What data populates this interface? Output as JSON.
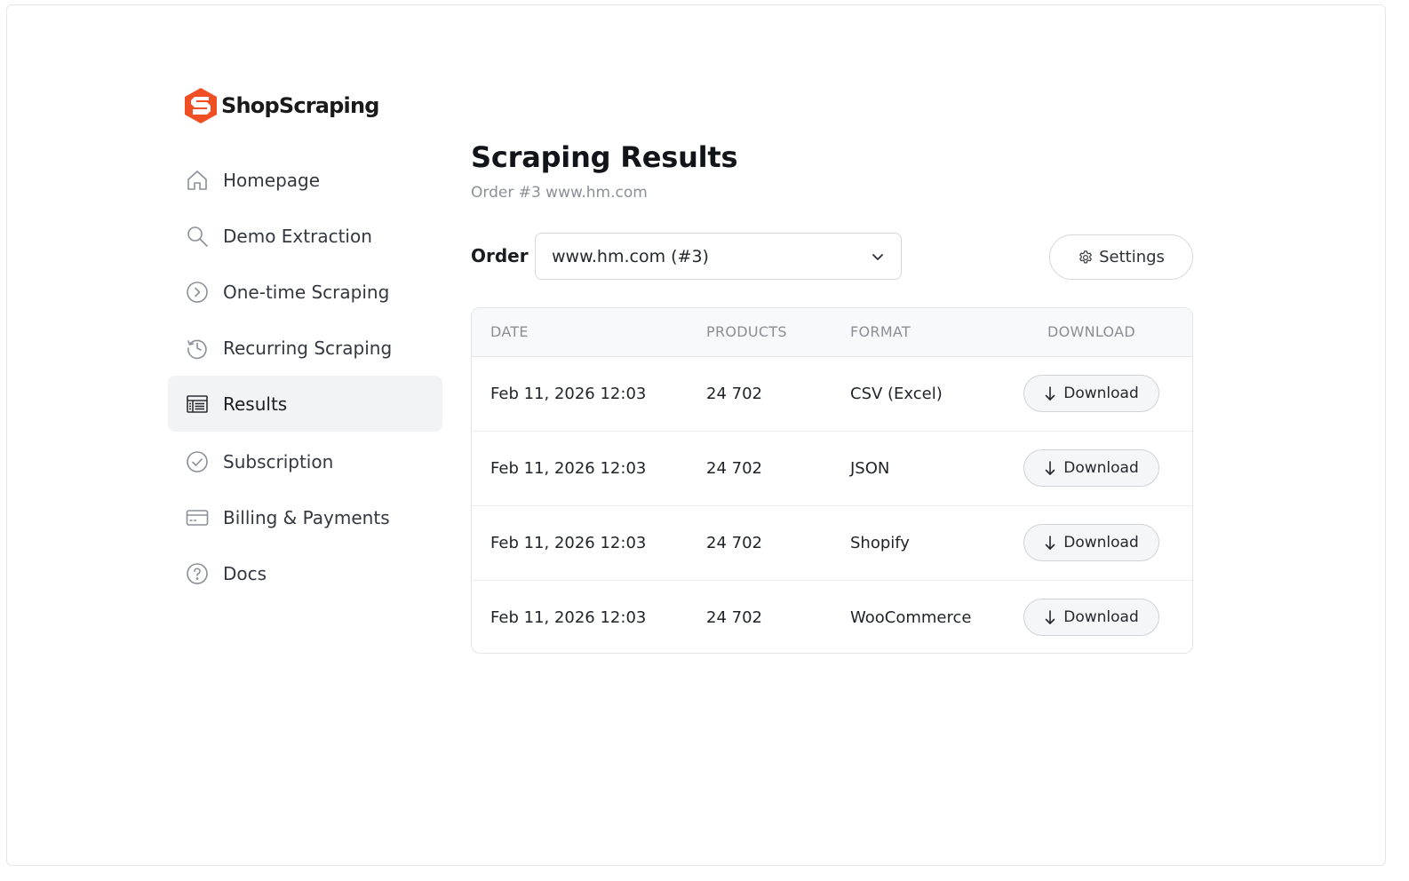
{
  "brand": {
    "name": "ShopScraping",
    "accent": "#f04e23"
  },
  "sidebar": {
    "items": [
      {
        "label": "Homepage",
        "icon": "home-icon"
      },
      {
        "label": "Demo Extraction",
        "icon": "search-icon"
      },
      {
        "label": "One-time Scraping",
        "icon": "chevron-circle-icon"
      },
      {
        "label": "Recurring Scraping",
        "icon": "history-icon"
      },
      {
        "label": "Results",
        "icon": "table-icon",
        "active": true
      },
      {
        "label": "Subscription",
        "icon": "check-circle-icon"
      },
      {
        "label": "Billing & Payments",
        "icon": "credit-card-icon"
      },
      {
        "label": "Docs",
        "icon": "question-circle-icon"
      }
    ]
  },
  "main": {
    "title": "Scraping Results",
    "subtitle": "Order #3 www.hm.com",
    "order_label": "Order",
    "order_select": {
      "selected": "www.hm.com (#3)"
    },
    "settings_label": "Settings",
    "table": {
      "columns": [
        "DATE",
        "PRODUCTS",
        "FORMAT",
        "DOWNLOAD"
      ],
      "download_label": "Download",
      "rows": [
        {
          "date": "Feb 11, 2026 12:03",
          "products": "24 702",
          "format": "CSV (Excel)"
        },
        {
          "date": "Feb 11, 2026 12:03",
          "products": "24 702",
          "format": "JSON"
        },
        {
          "date": "Feb 11, 2026 12:03",
          "products": "24 702",
          "format": "Shopify"
        },
        {
          "date": "Feb 11, 2026 12:03",
          "products": "24 702",
          "format": "WooCommerce"
        }
      ]
    }
  }
}
